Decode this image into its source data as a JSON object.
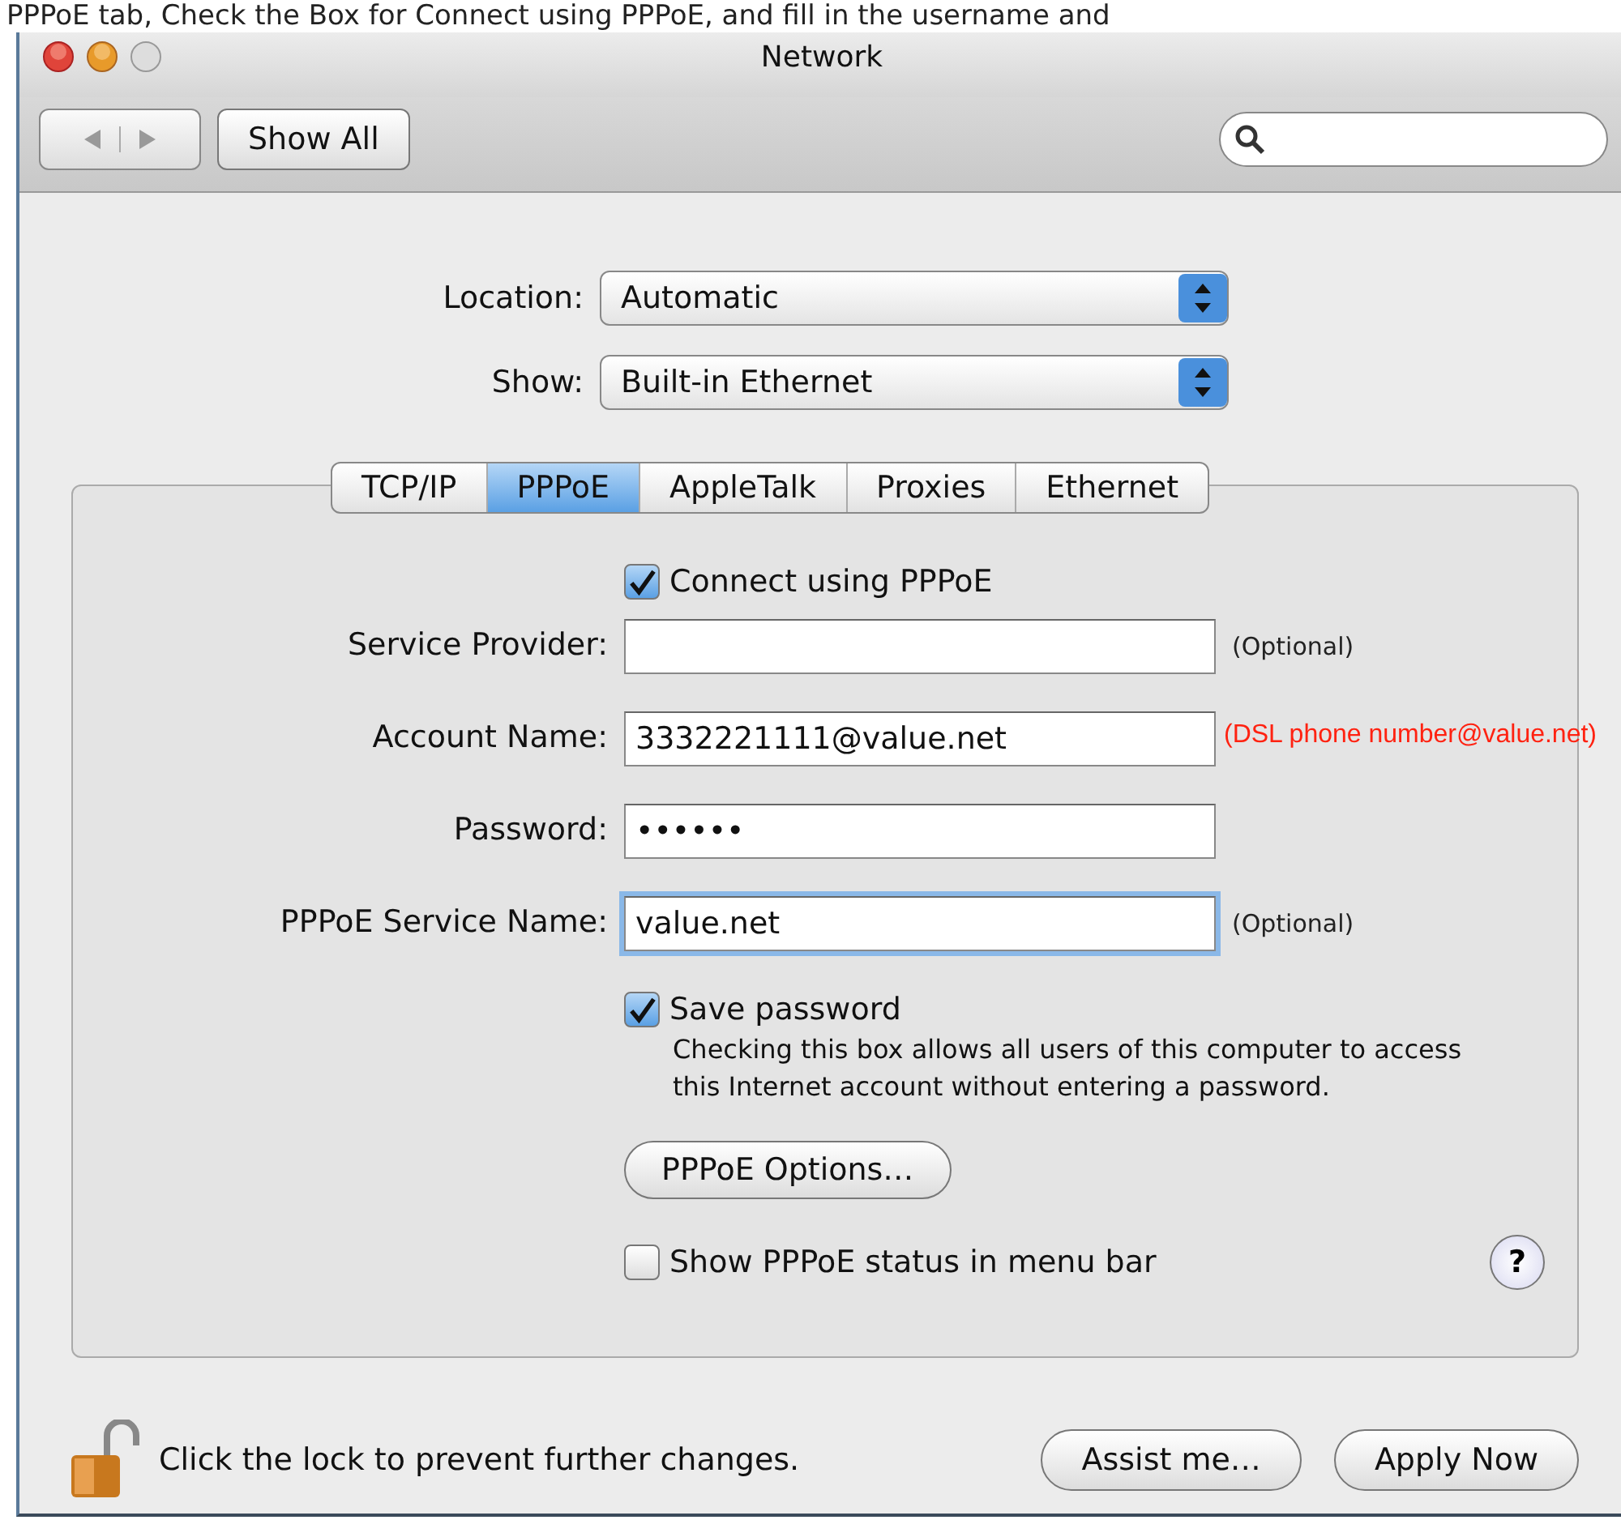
{
  "caption": "PPPoE tab, Check the Box for Connect using PPPoE, and fill in the username and",
  "window": {
    "title": "Network"
  },
  "toolbar": {
    "show_all": "Show All"
  },
  "popups": [
    {
      "label": "Location:",
      "value": "Automatic"
    },
    {
      "label": "Show:",
      "value": "Built-in Ethernet"
    }
  ],
  "tabs": [
    {
      "label": "TCP/IP",
      "selected": false
    },
    {
      "label": "PPPoE",
      "selected": true
    },
    {
      "label": "AppleTalk",
      "selected": false
    },
    {
      "label": "Proxies",
      "selected": false
    },
    {
      "label": "Ethernet",
      "selected": false
    }
  ],
  "connect": {
    "label": "Connect using PPPoE",
    "checked": true
  },
  "fields": [
    {
      "label": "Service Provider:",
      "note": "(Optional)",
      "focused": false
    },
    {
      "label": "Account Name:",
      "value": "3332221111@value.net",
      "annotation": "(DSL phone number@value.net)",
      "focused": false
    },
    {
      "label": "Password:",
      "value": "••••••",
      "focused": false
    },
    {
      "label": "PPPoE Service Name:",
      "value": "value.net",
      "note": "(Optional)",
      "focused": true
    }
  ],
  "save_password": {
    "label": "Save password",
    "checked": true,
    "description": "Checking this box allows all users of this computer to access this Internet account without entering a password."
  },
  "options_button": "PPPoE Options…",
  "status_checkbox": {
    "label": "Show PPPoE status in menu bar",
    "checked": false
  },
  "help": "?",
  "footer": {
    "lock_text": "Click the lock to prevent further changes.",
    "buttons": [
      "Assist me…",
      "Apply Now"
    ]
  }
}
